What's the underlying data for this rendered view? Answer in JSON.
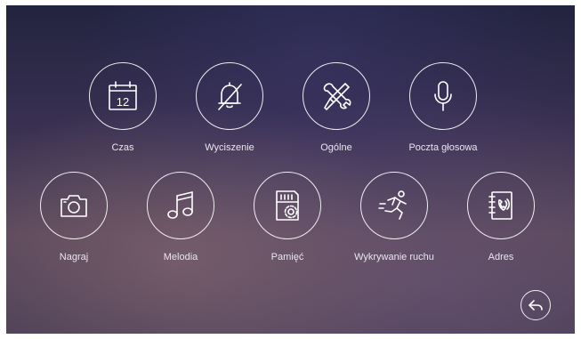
{
  "menu": {
    "items": [
      {
        "label": "Czas",
        "icon": "calendar-icon",
        "day": "12"
      },
      {
        "label": "Wyciszenie",
        "icon": "bell-off-icon"
      },
      {
        "label": "Ogólne",
        "icon": "tools-icon"
      },
      {
        "label": "Poczta głosowa",
        "icon": "microphone-icon"
      },
      {
        "label": "Nagraj",
        "icon": "camera-icon"
      },
      {
        "label": "Melodia",
        "icon": "music-note-icon"
      },
      {
        "label": "Pamięć",
        "icon": "sd-card-settings-icon"
      },
      {
        "label": "Wykrywanie ruchu",
        "icon": "running-person-icon"
      },
      {
        "label": "Adres",
        "icon": "address-book-icon"
      }
    ]
  },
  "back": {
    "icon": "back-arrow-icon"
  },
  "colors": {
    "icon_stroke": "#ffffff",
    "label_text": "#e8e6ee"
  }
}
